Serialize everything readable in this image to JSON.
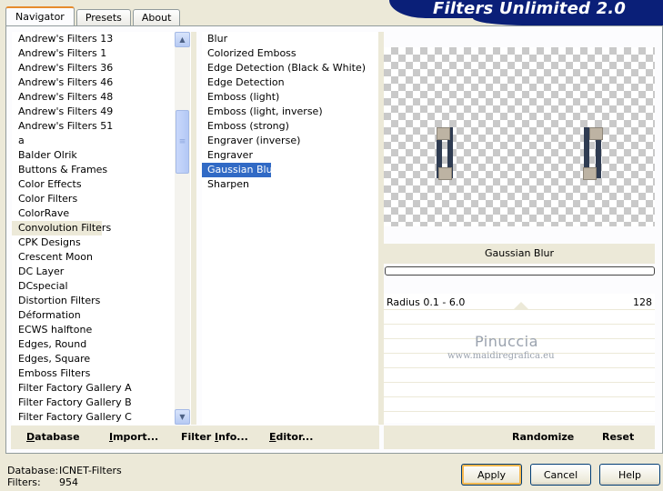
{
  "tabs": [
    {
      "label": "Navigator",
      "active": true
    },
    {
      "label": "Presets",
      "active": false
    },
    {
      "label": "About",
      "active": false
    }
  ],
  "banner": {
    "title": "Filters Unlimited 2.0"
  },
  "categories": [
    "Andrew's Filters 13",
    "Andrew's Filters 1",
    "Andrew's Filters 36",
    "Andrew's Filters 46",
    "Andrew's Filters 48",
    "Andrew's Filters 49",
    "Andrew's Filters 51",
    "a",
    "Balder Olrik",
    "Buttons & Frames",
    "Color Effects",
    "Color Filters",
    "ColorRave",
    "Convolution Filters",
    "CPK Designs",
    "Crescent Moon",
    "DC Layer",
    "DCspecial",
    "Distortion Filters",
    "Déformation",
    "ECWS halftone",
    "Edges, Round",
    "Edges, Square",
    "Emboss Filters",
    "Filter Factory Gallery A",
    "Filter Factory Gallery B",
    "Filter Factory Gallery C"
  ],
  "selected_category": "Convolution Filters",
  "filters": [
    "Blur",
    "Colorized Emboss",
    "Edge Detection (Black & White)",
    "Edge Detection",
    "Emboss (light)",
    "Emboss (light, inverse)",
    "Emboss (strong)",
    "Engraver (inverse)",
    "Engraver",
    "Gaussian Blur",
    "Sharpen"
  ],
  "selected_filter": "Gaussian Blur",
  "preview": {
    "filter_title": "Gaussian Blur"
  },
  "params": [
    {
      "label": "Radius 0.1 - 6.0",
      "value": "128"
    }
  ],
  "watermark": {
    "line1": "Pinuccia",
    "line2": "www.maidiregrafica.eu"
  },
  "toolbar": {
    "database": {
      "ul": "D",
      "rest": "atabase"
    },
    "import": {
      "ul": "I",
      "rest": "mport..."
    },
    "filter_info": {
      "pre": "Filter ",
      "ul": "I",
      "rest": "nfo..."
    },
    "editor": {
      "ul": "E",
      "rest": "ditor..."
    },
    "randomize": "Randomize",
    "reset": "Reset"
  },
  "footer": {
    "database_label": "Database:",
    "database_value": "ICNET-Filters",
    "filters_label": "Filters:",
    "filters_value": "954"
  },
  "buttons": {
    "apply": "Apply",
    "cancel": "Cancel",
    "help": "Help"
  },
  "colors": {
    "banner": "#0a1f78",
    "selection": "#316ac5",
    "window_bg": "#ece9d8"
  }
}
